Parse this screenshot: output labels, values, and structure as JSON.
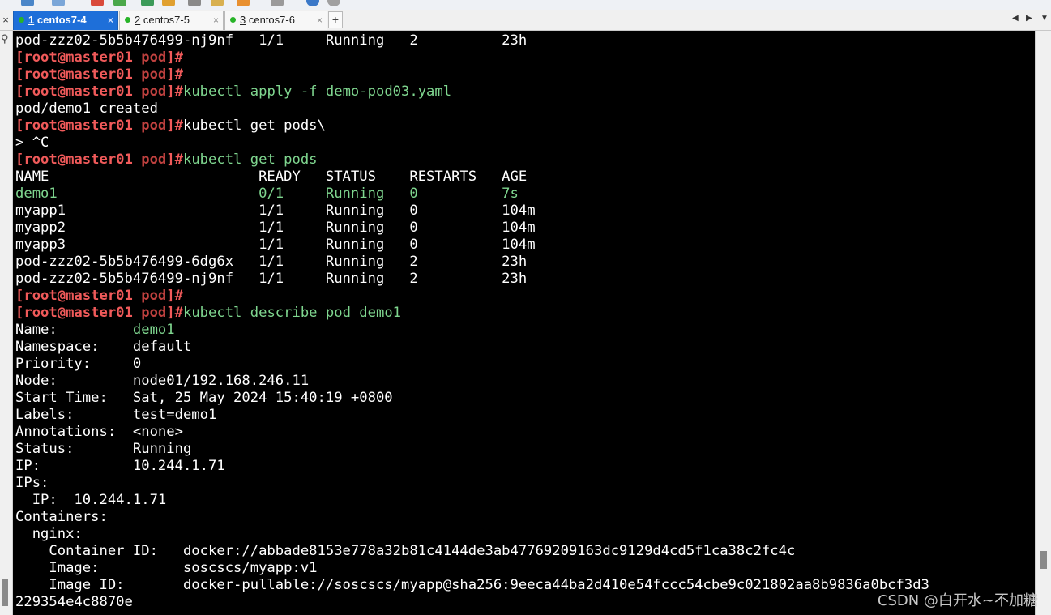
{
  "tabs": [
    {
      "number": "1",
      "label": "centos7-4",
      "active": true
    },
    {
      "number": "2",
      "label": "centos7-5",
      "active": false
    },
    {
      "number": "3",
      "label": "centos7-6",
      "active": false
    }
  ],
  "tab_close_symbol": "×",
  "tab_add_symbol": "+",
  "tab_close_all_symbol": "×",
  "prompt": {
    "user": "[root@master01 ",
    "path": "pod",
    "end": "]#"
  },
  "terminal": {
    "l00": "pod-zzz02-5b5b476499-nj9nf   1/1     Running   2          23h",
    "l01_cmd": "",
    "l02_cmd": "",
    "l03_cmd": "kubectl apply -f demo-pod03.yaml",
    "l04": "pod/demo1 created",
    "l05_cmd": "kubectl get pods\\",
    "l06": "> ^C",
    "l07_cmd": "kubectl get pods",
    "l08": "NAME                         READY   STATUS    RESTARTS   AGE",
    "l09": "demo1                        0/1     Running   0          7s",
    "l10": "myapp1                       1/1     Running   0          104m",
    "l11": "myapp2                       1/1     Running   0          104m",
    "l12": "myapp3                       1/1     Running   0          104m",
    "l13": "pod-zzz02-5b5b476499-6dg6x   1/1     Running   2          23h",
    "l14": "pod-zzz02-5b5b476499-nj9nf   1/1     Running   2          23h",
    "l15_cmd": "",
    "l16_cmd": "kubectl describe pod demo1",
    "l17_key": "Name:         ",
    "l17_val": "demo1",
    "l18": "Namespace:    default",
    "l19": "Priority:     0",
    "l20": "Node:         node01/192.168.246.11",
    "l21": "Start Time:   Sat, 25 May 2024 15:40:19 +0800",
    "l22": "Labels:       test=demo1",
    "l23": "Annotations:  <none>",
    "l24": "Status:       Running",
    "l25": "IP:           10.244.1.71",
    "l26": "IPs:",
    "l27": "  IP:  10.244.1.71",
    "l28": "Containers:",
    "l29": "  nginx:",
    "l30": "    Container ID:   docker://abbade8153e778a32b81c4144de3ab47769209163dc9129d4cd5f1ca38c2fc4c",
    "l31": "    Image:          soscscs/myapp:v1",
    "l32": "    Image ID:       docker-pullable://soscscs/myapp@sha256:9eeca44ba2d410e54fccc54cbe9c021802aa8b9836a0bcf3d3",
    "l33": "229354e4c8870e"
  },
  "watermark": "CSDN @白开水~不加糖",
  "colors": {
    "prompt": "#f05a5a",
    "command": "#7fd68f",
    "active_tab": "#1e6fd9"
  },
  "icons": [
    "search-icon",
    "chevron-left-icon",
    "chevron-right-icon",
    "chevron-down-icon"
  ]
}
